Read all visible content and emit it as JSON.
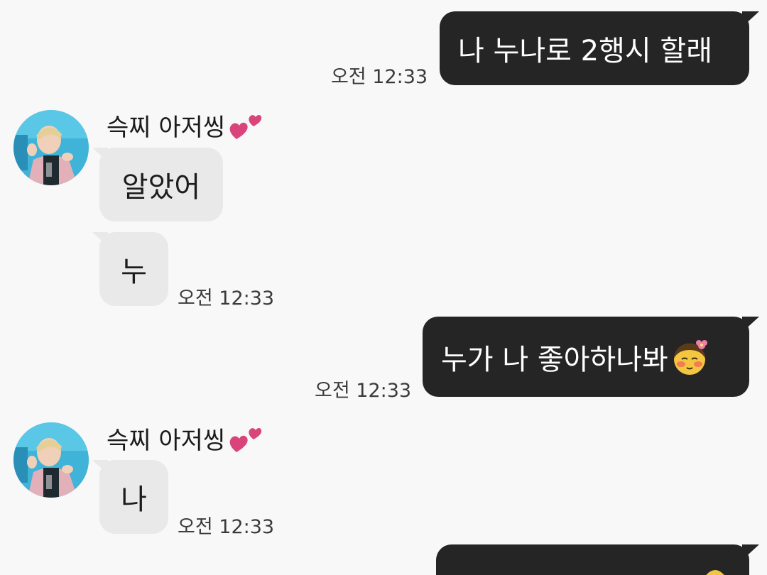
{
  "messages": [
    {
      "text": "나 누나로 2행시 할래",
      "time": "오전 12:33"
    },
    {
      "sender": "슥찌 아저씽",
      "text": "알았어"
    },
    {
      "text": "누",
      "time": "오전 12:33"
    },
    {
      "text": "누가 나 좋아하나봐",
      "time": "오전 12:33",
      "emoji_icon": "blushing-face-with-flower-icon"
    },
    {
      "sender": "슥찌 아저씽",
      "text": "나",
      "time": "오전 12:33"
    }
  ],
  "colors": {
    "background": "#f8f8f8",
    "outgoing_bubble": "#252525",
    "incoming_bubble": "#e9e9e9",
    "heart": "#d9457a"
  },
  "icons": {
    "sender_decoration": "two-hearts-icon"
  }
}
